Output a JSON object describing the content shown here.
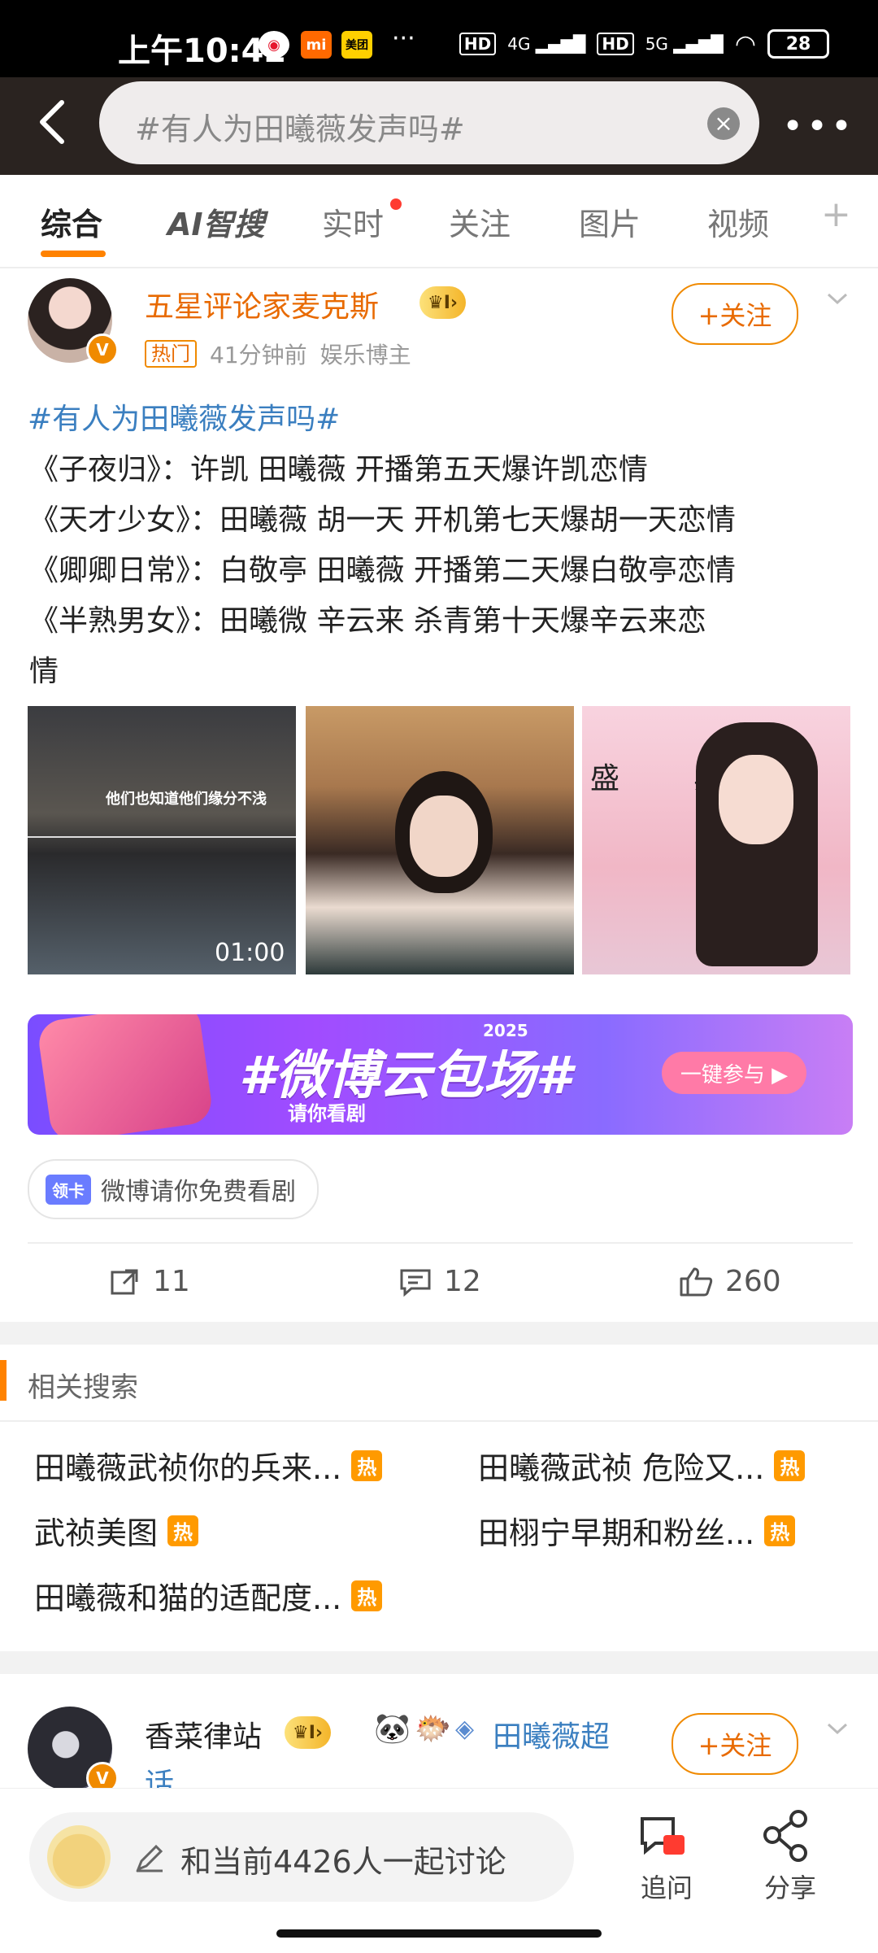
{
  "status": {
    "time": "上午10:42",
    "battery": "28",
    "net1": "4G",
    "net2": "5G",
    "hd": "HD"
  },
  "header": {
    "query": "#有人为田曦薇发声吗#",
    "clear": "×",
    "more": "•••"
  },
  "tabs": [
    "综合",
    "AI智搜",
    "实时",
    "关注",
    "图片",
    "视频",
    "+"
  ],
  "post": {
    "author": "五星评论家麦克斯",
    "level": "I",
    "hot_label": "热门",
    "time": "41分钟前",
    "role": "娱乐博主",
    "follow": "+关注",
    "topic": "#有人为田曦薇发声吗#",
    "lines": [
      "《子夜归》：许凯 田曦薇 开播第五天爆许凯恋情",
      "《天才少女》：田曦薇 胡一天 开机第七天爆胡一天恋情",
      "《卿卿日常》：白敬亭 田曦薇 开播第二天爆白敬亭恋情",
      "《半熟男女》：田曦微 辛云来 杀青第十天爆辛云来恋",
      "情"
    ],
    "video_time": "01:00",
    "thumb1_caption": "他们也知道他们缘分不浅",
    "thumb3_text": "盛 典",
    "banner": {
      "year": "2025",
      "title": "#微博云包场#",
      "sub": "请你看剧",
      "cta": "一键参与 ▶"
    },
    "chip": {
      "badge": "领卡",
      "text": "微博请你免费看剧"
    },
    "actions": {
      "repost": "11",
      "comment": "12",
      "like": "260"
    }
  },
  "related": {
    "title": "相关搜索",
    "hot": "热",
    "items": [
      "田曦薇武祯你的兵来...",
      "田曦薇武祯 危险又...",
      "武祯美图",
      "田栩宁早期和粉丝...",
      "田曦薇和猫的适配度..."
    ]
  },
  "post2": {
    "author": "香菜律站",
    "level": "I",
    "topic": "田曦薇超",
    "topic2": "话",
    "follow": "+关注"
  },
  "bottom": {
    "placeholder": "和当前4426人一起讨论",
    "ask": "追问",
    "share": "分享"
  }
}
